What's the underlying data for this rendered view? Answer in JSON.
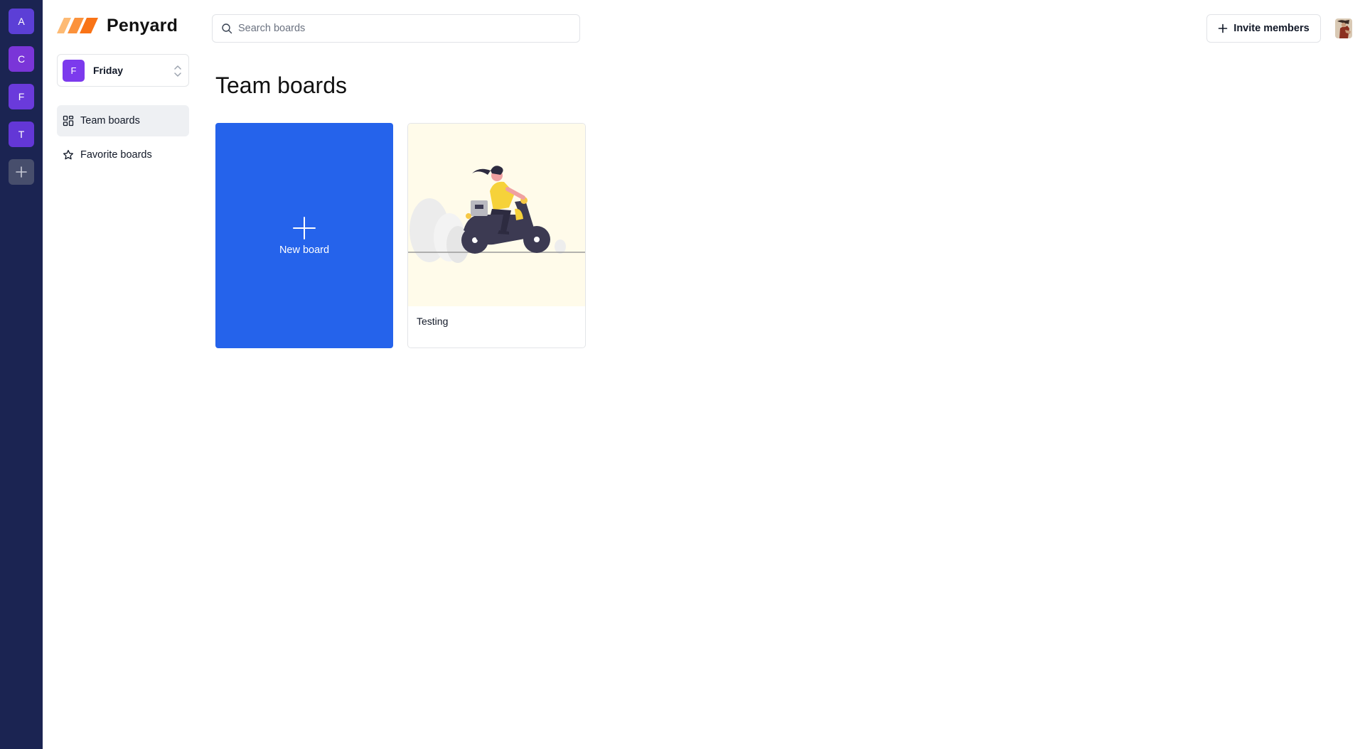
{
  "org_rail": {
    "orgs": [
      {
        "initial": "A",
        "color": "#5c3fd6"
      },
      {
        "initial": "C",
        "color": "#7a35d8"
      },
      {
        "initial": "F",
        "color": "#6a3adb"
      },
      {
        "initial": "T",
        "color": "#6337d6"
      }
    ],
    "add_icon": "plus-icon"
  },
  "sidebar": {
    "logo_text": "Penyard",
    "org_selector": {
      "initial": "F",
      "name": "Friday",
      "avatar_color": "#7c3aed",
      "icon": "chevron-up-down-icon"
    },
    "nav": [
      {
        "label": "Team boards",
        "icon": "grid-icon",
        "active": true
      },
      {
        "label": "Favorite boards",
        "icon": "star-icon",
        "active": false
      }
    ]
  },
  "header": {
    "search_placeholder": "Search boards",
    "search_value": "",
    "invite_label": "Invite members"
  },
  "main": {
    "title": "Team boards",
    "new_board_label": "New board",
    "boards": [
      {
        "title": "Testing"
      }
    ]
  },
  "colors": {
    "rail": "#1b2452",
    "accent": "#2563eb",
    "logo_orange": "#f97316"
  }
}
